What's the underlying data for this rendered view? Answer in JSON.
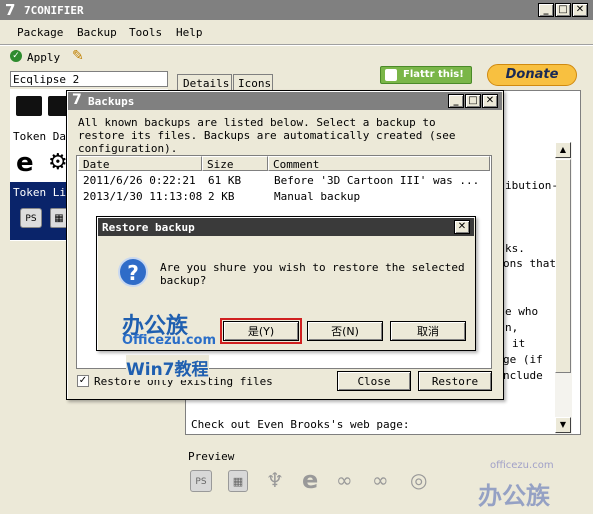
{
  "app": {
    "title": "7CONIFIER",
    "logo_glyph": "7",
    "menu": [
      "Package",
      "Backup",
      "Tools",
      "Help"
    ],
    "toolbar": {
      "apply_label": "Apply"
    },
    "package_field_value": "Ecqlipse 2",
    "left_labels": [
      "Token Dar",
      "Token Li"
    ],
    "tabs": [
      "Details",
      "Icons"
    ],
    "flattr_label": "Flattr this!",
    "donate_label": "Donate",
    "right_text_fragments": [
      "ibution-",
      "ks.",
      "ons that",
      "e who",
      "n,",
      "it",
      "ge (if",
      "nclude"
    ],
    "credits_line": "Check out Even Brooks's web page:",
    "preview_label": "Preview",
    "watermark_site": "officezu.com",
    "watermark_brand": "办公族"
  },
  "backups_window": {
    "title": "Backups",
    "logo_glyph": "7",
    "description": "All known backups are listed below. Select a backup to restore its files. Backups are automatically created (see configuration).",
    "columns": [
      "Date",
      "Size",
      "Comment"
    ],
    "rows": [
      {
        "date": "2011/6/26 0:22:21",
        "size": "61 KB",
        "comment": "Before '3D Cartoon III' was ..."
      },
      {
        "date": "2013/1/30 11:13:08",
        "size": "2 KB",
        "comment": "Manual backup"
      }
    ],
    "checkbox_label": "Restore only existing files",
    "checkbox_checked": true,
    "close_label": "Close",
    "restore_label": "Restore"
  },
  "restore_dialog": {
    "title": "Restore backup",
    "message_line1": "Are you shure you wish to restore the selected",
    "message_line2": "backup?",
    "yes_label": "是(Y)",
    "no_label": "否(N)",
    "cancel_label": "取消",
    "watermark_brand": "办公族",
    "watermark_site": "Officezu.com",
    "watermark_win7": "Win7教程"
  }
}
